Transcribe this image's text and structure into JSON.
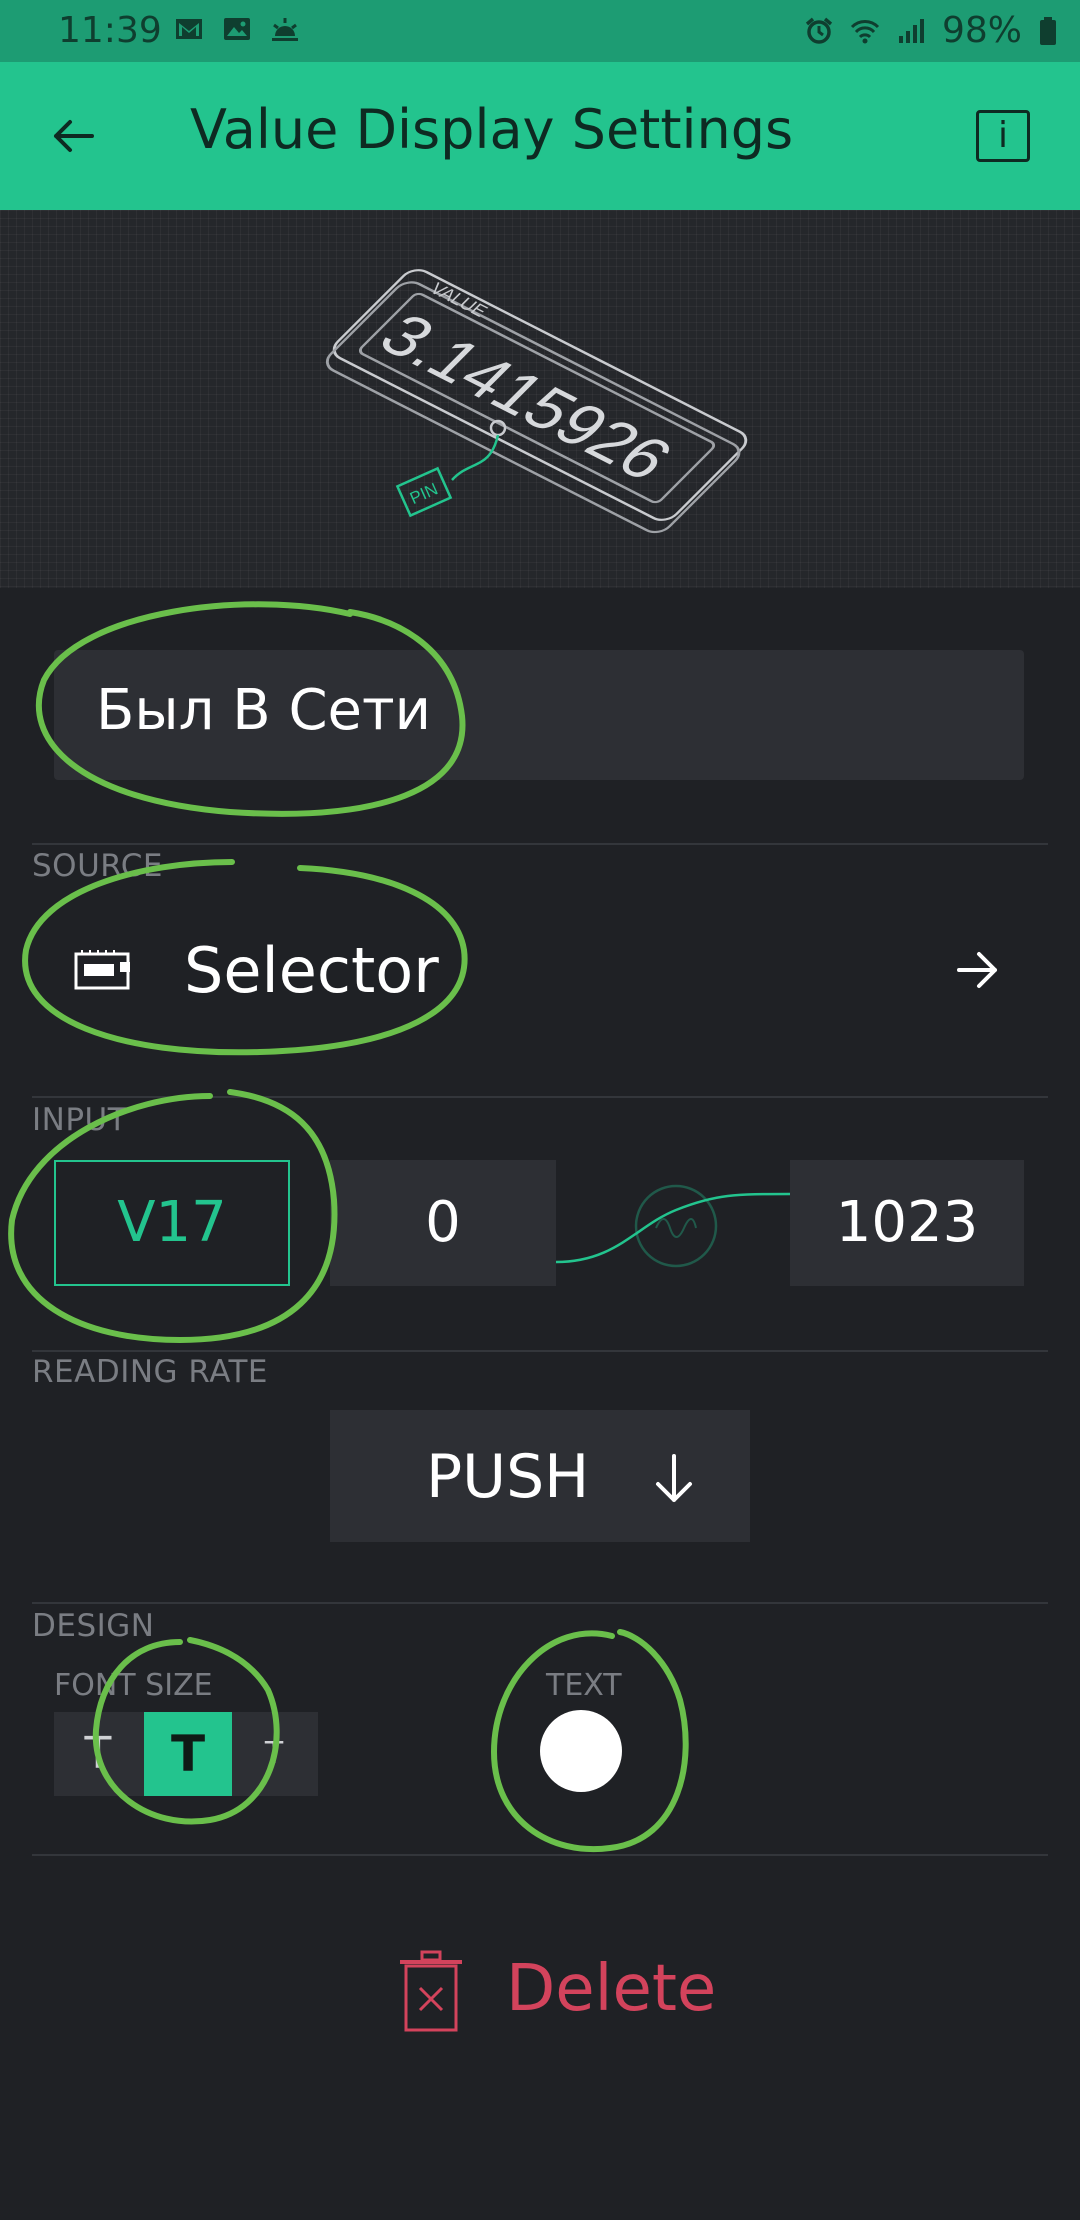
{
  "status_bar": {
    "time": "11:39",
    "battery": "98%",
    "left_icons": [
      "gmail-icon",
      "image-icon",
      "weather-icon"
    ],
    "right_icons": [
      "alarm-icon",
      "wifi-icon",
      "signal-icon",
      "battery-icon"
    ]
  },
  "app_bar": {
    "title": "Value Display Settings",
    "back_icon": "arrow-left-icon",
    "info_label": "i"
  },
  "preview": {
    "value_label": "VALUE",
    "value_number": "3.1415926",
    "pin_label": "PIN"
  },
  "widget_name": {
    "value": "Был В Сети"
  },
  "source": {
    "section_label": "SOURCE",
    "label": "Selector"
  },
  "input": {
    "section_label": "INPUT",
    "pin": "V17",
    "min": "0",
    "max": "1023"
  },
  "reading_rate": {
    "section_label": "READING RATE",
    "value": "PUSH"
  },
  "design": {
    "section_label": "DESIGN",
    "font_size_label": "FONT SIZE",
    "font_options": [
      "T",
      "T",
      "T"
    ],
    "selected_font_index": 1,
    "text_color_label": "TEXT",
    "text_color": "#ffffff"
  },
  "delete": {
    "label": "Delete"
  },
  "colors": {
    "accent": "#23c48e",
    "background": "#1f2125",
    "field": "#2d2f34",
    "danger": "#d3435c",
    "annotation": "#6abf4b"
  }
}
